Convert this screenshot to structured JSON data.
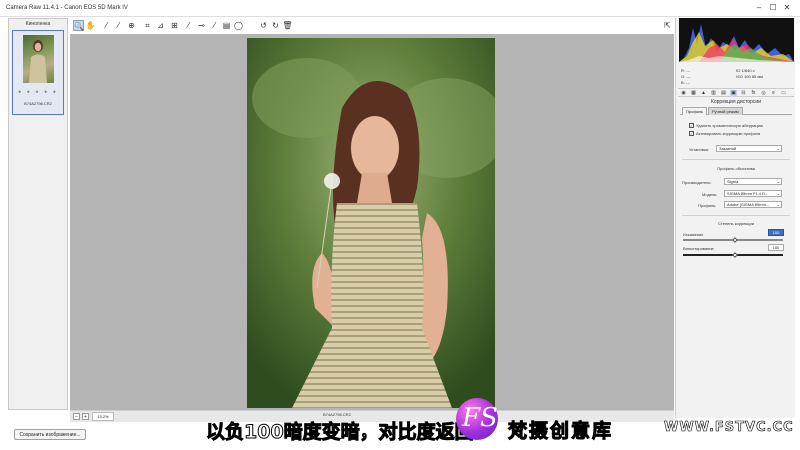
{
  "window": {
    "title": "Camera Raw 11.4.1  -  Canon EOS 5D Mark IV"
  },
  "toolbar": {
    "tools": [
      "zoom-icon",
      "hand-icon",
      "white-balance-icon",
      "color-sampler-icon",
      "targeted-adjust-icon",
      "crop-icon",
      "straighten-icon",
      "spot-removal-icon",
      "red-eye-icon",
      "adjustment-brush-icon",
      "graduated-filter-icon",
      "radial-filter-icon",
      "rotate-left-icon",
      "rotate-right-icon",
      "trash-icon"
    ],
    "active_tool": "zoom-icon",
    "preferences_icon": "open-preferences-icon"
  },
  "filmstrip": {
    "header": "Киноленка",
    "items": [
      {
        "name": "B74A2798.CR2",
        "stars": "★ ★ ★ ★ ★",
        "selected": true
      }
    ]
  },
  "canvas": {
    "photo_description_icon": "portrait-photo"
  },
  "statusbar": {
    "zoom_out": "−",
    "zoom_in": "+",
    "zoom_value": "13.2%",
    "filename": "B74A2798.CR2"
  },
  "save_button": "Сохранить изображение...",
  "right_panel": {
    "cam_info": [
      {
        "left": "R:   ---",
        "right": "f/2    1/640 с"
      },
      {
        "left": "G:   ---",
        "right": "ISO 100   85 мм"
      },
      {
        "left": "B:   ---",
        "right": ""
      }
    ],
    "panel_tabs": [
      "basic-icon",
      "tone-curve-icon",
      "detail-icon",
      "hsl-icon",
      "split-toning-icon",
      "lens-corrections-icon",
      "transform-icon",
      "effects-icon",
      "camera-calibration-icon",
      "presets-icon",
      "snapshots-icon"
    ],
    "active_panel": "lens-corrections-icon",
    "section_title": "Коррекция дисторсии",
    "tabs": [
      {
        "label": "Профиль",
        "active": true
      },
      {
        "label": "Ручной режим",
        "active": false
      }
    ],
    "checkboxes": [
      {
        "label": "Удалить хроматическую аберрацию",
        "checked": "✓"
      },
      {
        "label": "Активировать коррекцию профиля",
        "checked": "✓"
      }
    ],
    "setup_label": "Установка:",
    "setup_value": "Заказной",
    "lens_profile_title": "Профиль объектива",
    "make_label": "Производитель:",
    "make_value": "Sigma",
    "model_label": "Модель:",
    "model_value": "SIGMA 85mm F1.4 D...",
    "profile_label": "Профиль:",
    "profile_value": "Adobe (SIGMA 85mm...",
    "amount_title": "Степень коррекции",
    "distortion_label": "Искажение",
    "distortion_value": "100",
    "vignetting_label": "Виньетирование",
    "vignetting_value": "100"
  },
  "subtitle": "以负100暗度变暗，对比度返回",
  "watermark": {
    "logo": "FS",
    "cn": "梵摄创意库",
    "url": "WWW.FSTVC.CC"
  },
  "colors": {
    "accent": "#3b6fc6",
    "panel_bg": "#f2f2f2",
    "canvas_bg": "#b4b4b4"
  }
}
